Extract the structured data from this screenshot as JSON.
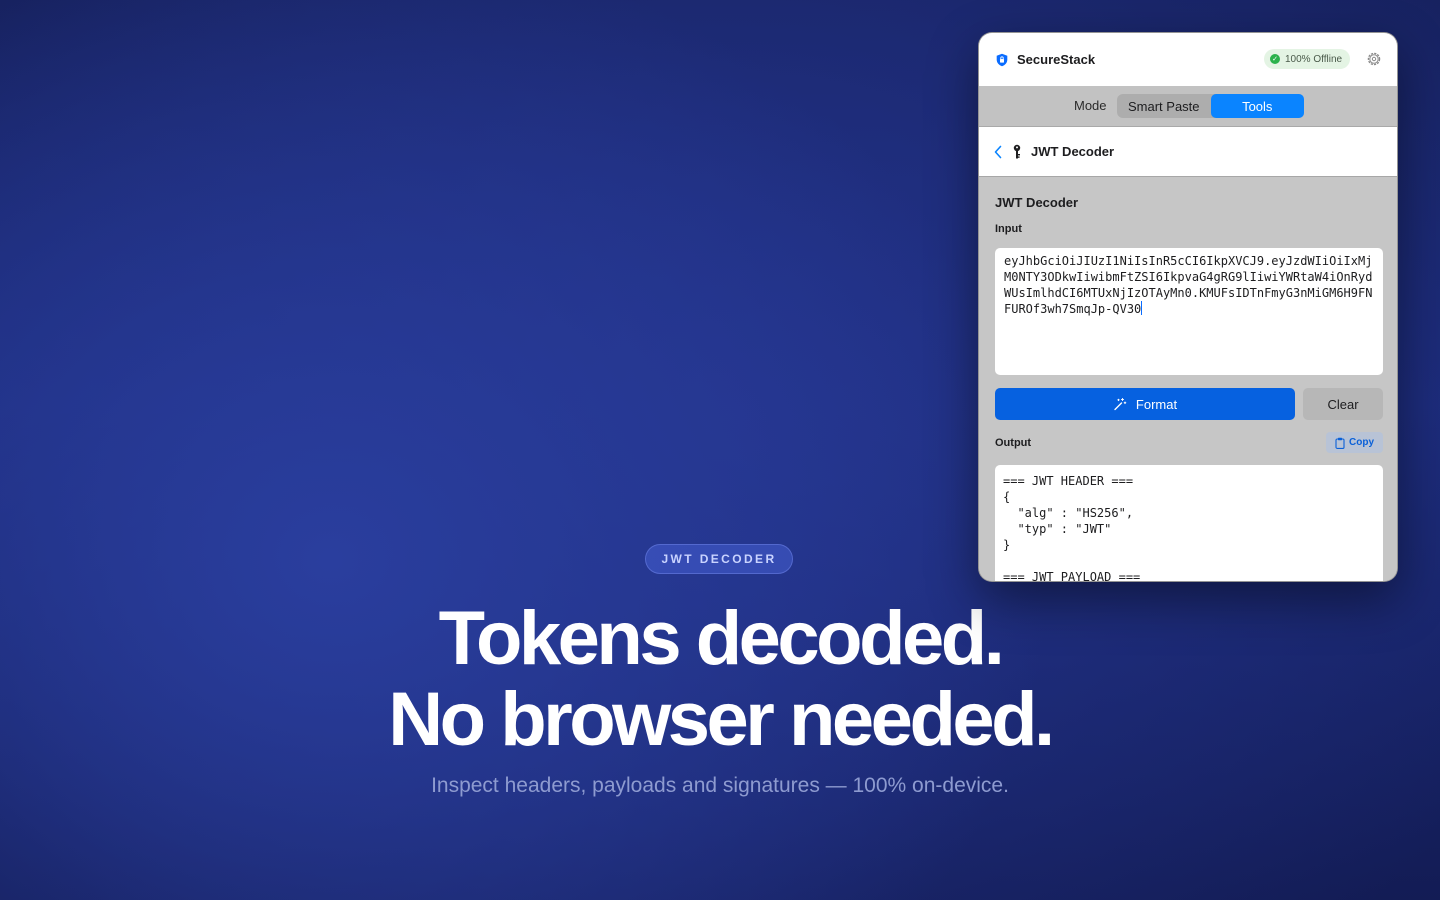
{
  "hero": {
    "badge": "JWT DECODER",
    "headline_line1": "Tokens decoded.",
    "headline_line2": "No browser needed.",
    "subline": "Inspect headers, payloads and signatures — 100% on-device."
  },
  "window": {
    "app_name": "SecureStack",
    "status": "100% Offline",
    "app_icon": "shield-icon",
    "settings_icon": "gear-icon"
  },
  "mode": {
    "label": "Mode",
    "options": [
      "Smart Paste",
      "Tools"
    ],
    "selected": "Tools"
  },
  "tool_header": {
    "title": "JWT Decoder",
    "back_icon": "chevron-left-icon",
    "tool_icon": "key-icon"
  },
  "decoder": {
    "section_title": "JWT Decoder",
    "input_label": "Input",
    "input_value": "eyJhbGciOiJIUzI1NiIsInR5cCI6IkpXVCJ9.eyJzdWIiOiIxMjM0NTY3ODkwIiwibmFtZSI6IkpvaG4gRG9lIiwiYWRtaW4iOnRydWUsImlhdCI6MTUxNjIzOTAyMn0.KMUFsIDTnFmyG3nMiGM6H9FNFUROf3wh7SmqJp-QV30",
    "format_label": "Format",
    "clear_label": "Clear",
    "output_label": "Output",
    "copy_label": "Copy",
    "output_value": "=== JWT HEADER ===\n{\n  \"alg\" : \"HS256\",\n  \"typ\" : \"JWT\"\n}\n\n=== JWT PAYLOAD ==="
  },
  "colors": {
    "accent": "#0a84ff",
    "format_button": "#0661e0",
    "status_green": "#2bb24c",
    "background_deep": "#172260"
  }
}
